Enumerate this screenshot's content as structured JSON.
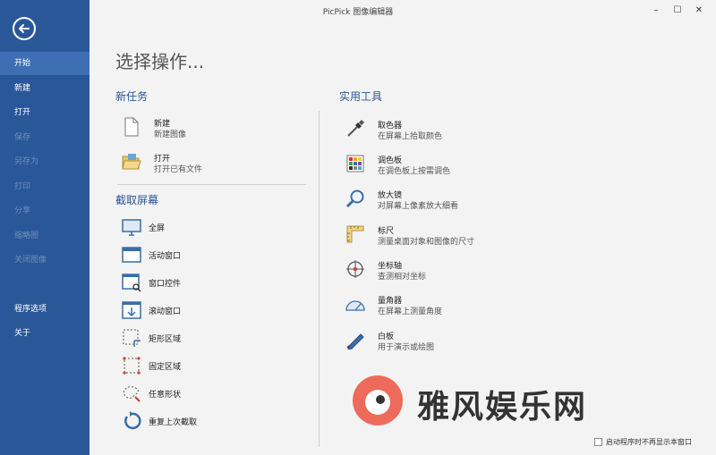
{
  "window": {
    "title": "PicPick 图像编辑器",
    "minimize": "–",
    "maximize": "☐",
    "close": "✕"
  },
  "sidebar": {
    "items": [
      {
        "label": "开始",
        "state": "selected"
      },
      {
        "label": "新建",
        "state": "enabled"
      },
      {
        "label": "打开",
        "state": "enabled"
      },
      {
        "label": "保存",
        "state": "disabled"
      },
      {
        "label": "另存为",
        "state": "disabled"
      },
      {
        "label": "打印",
        "state": "disabled"
      },
      {
        "label": "分享",
        "state": "disabled"
      },
      {
        "label": "缩略图",
        "state": "disabled"
      },
      {
        "label": "关闭图像",
        "state": "disabled"
      },
      {
        "label": "程序选项",
        "state": "enabled"
      },
      {
        "label": "关于",
        "state": "enabled"
      }
    ]
  },
  "main": {
    "heading": "选择操作...",
    "new_task": {
      "title": "新任务",
      "items": [
        {
          "title": "新建",
          "desc": "新建图像",
          "icon": "new-file-icon"
        },
        {
          "title": "打开",
          "desc": "打开已有文件",
          "icon": "open-folder-icon"
        }
      ]
    },
    "capture": {
      "title": "截取屏幕",
      "items": [
        {
          "label": "全屏",
          "icon": "monitor-icon"
        },
        {
          "label": "活动窗口",
          "icon": "window-icon"
        },
        {
          "label": "窗口控件",
          "icon": "window-control-icon"
        },
        {
          "label": "滚动窗口",
          "icon": "scroll-window-icon"
        },
        {
          "label": "矩形区域",
          "icon": "rectangle-region-icon"
        },
        {
          "label": "固定区域",
          "icon": "fixed-region-icon"
        },
        {
          "label": "任意形状",
          "icon": "freehand-icon"
        },
        {
          "label": "重复上次截取",
          "icon": "repeat-icon"
        }
      ]
    },
    "tools": {
      "title": "实用工具",
      "items": [
        {
          "title": "取色器",
          "desc": "在屏幕上拾取颜色",
          "icon": "eyedropper-icon"
        },
        {
          "title": "调色板",
          "desc": "在调色板上按需调色",
          "icon": "palette-icon"
        },
        {
          "title": "放大镜",
          "desc": "对屏幕上像素放大细看",
          "icon": "magnifier-icon"
        },
        {
          "title": "标尺",
          "desc": "测量桌面对象和图像的尺寸",
          "icon": "ruler-icon"
        },
        {
          "title": "坐标轴",
          "desc": "查测相对坐标",
          "icon": "crosshair-icon"
        },
        {
          "title": "量角器",
          "desc": "在屏幕上测量角度",
          "icon": "protractor-icon"
        },
        {
          "title": "白板",
          "desc": "用于演示或绘图",
          "icon": "whiteboard-pen-icon"
        }
      ]
    }
  },
  "footer": {
    "checkbox_label": "启动程序时不再显示本窗口",
    "checked": false
  },
  "watermark": {
    "text": "雅风娱乐网"
  },
  "colors": {
    "sidebar": "#2a5798",
    "sidebar_selected": "#3e6fb4",
    "accent": "#2b5797",
    "background": "#f3f3f3"
  }
}
